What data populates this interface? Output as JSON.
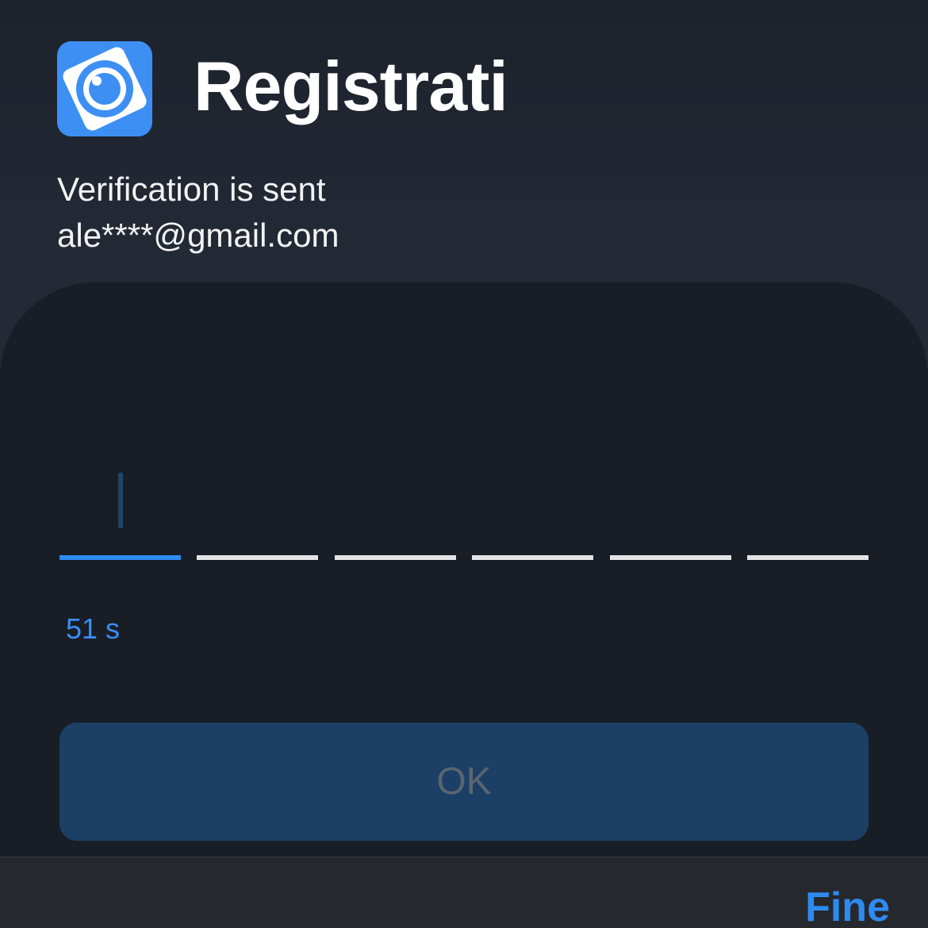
{
  "header": {
    "title": "Registrati",
    "app_icon": "eye-camera-icon",
    "accent": "#3d8ff3"
  },
  "message": {
    "line1": "Verification is sent",
    "line2": "ale****@gmail.com"
  },
  "code": {
    "length": 6,
    "active_index": 0,
    "countdown": "51 s"
  },
  "ok_label": "OK",
  "keyboard_toolbar": {
    "done_label": "Fine"
  }
}
